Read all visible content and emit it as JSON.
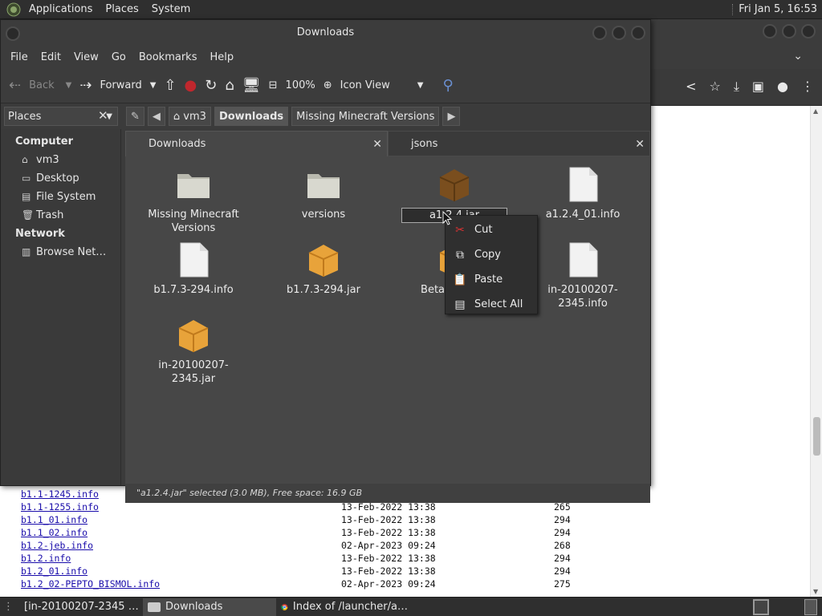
{
  "top_panel": {
    "menus": [
      "Applications",
      "Places",
      "System"
    ],
    "clock": "Fri Jan 5, 16:53"
  },
  "chrome": {
    "listing": [
      {
        "name": "b1.1-1245.info",
        "date": "13-Feb-2022 13:38",
        "size": "265"
      },
      {
        "name": "b1.1-1255.info",
        "date": "13-Feb-2022 13:38",
        "size": "265"
      },
      {
        "name": "b1.1_01.info",
        "date": "13-Feb-2022 13:38",
        "size": "294"
      },
      {
        "name": "b1.1_02.info",
        "date": "13-Feb-2022 13:38",
        "size": "294"
      },
      {
        "name": "b1.2-jeb.info",
        "date": "02-Apr-2023 09:24",
        "size": "268"
      },
      {
        "name": "b1.2.info",
        "date": "13-Feb-2022 13:38",
        "size": "294"
      },
      {
        "name": "b1.2_01.info",
        "date": "13-Feb-2022 13:38",
        "size": "294"
      },
      {
        "name": "b1.2_02-PEPTO_BISMOL.info",
        "date": "02-Apr-2023 09:24",
        "size": "275"
      }
    ]
  },
  "nautilus": {
    "title": "Downloads",
    "menu": [
      "File",
      "Edit",
      "View",
      "Go",
      "Bookmarks",
      "Help"
    ],
    "toolbar": {
      "back": "Back",
      "forward": "Forward",
      "zoom": "100%",
      "view_mode": "Icon View"
    },
    "places_label": "Places",
    "breadcrumbs": [
      "vm3",
      "Downloads",
      "Missing Minecraft Versions"
    ],
    "sidebar": {
      "computer_header": "Computer",
      "computer_items": [
        "vm3",
        "Desktop",
        "File System",
        "Trash"
      ],
      "network_header": "Network",
      "network_items": [
        "Browse Net…"
      ]
    },
    "tabs": [
      "Downloads",
      "jsons"
    ],
    "files": [
      {
        "label": "Missing Minecraft Versions",
        "type": "folder"
      },
      {
        "label": "versions",
        "type": "folder"
      },
      {
        "label": "a1.2.4.jar",
        "type": "jar-selected"
      },
      {
        "label": "a1.2.4_01.info",
        "type": "doc"
      },
      {
        "label": "b1.7.3-294.info",
        "type": "doc"
      },
      {
        "label": "b1.7.3-294.jar",
        "type": "jar"
      },
      {
        "label": "Betacra Arch",
        "type": "jar"
      },
      {
        "label": "in-20100207-2345.info",
        "type": "doc"
      },
      {
        "label": "in-20100207-2345.jar",
        "type": "jar"
      }
    ],
    "status": "\"a1.2.4.jar\" selected (3.0 MB), Free space: 16.9 GB"
  },
  "context_menu": {
    "items": [
      {
        "label": "Cut",
        "icon": "scissors-icon"
      },
      {
        "label": "Copy",
        "icon": "copy-icon"
      },
      {
        "label": "Paste",
        "icon": "paste-icon"
      },
      {
        "label": "Select All",
        "icon": "select-all-icon"
      }
    ]
  },
  "taskbar": {
    "tasks": [
      "[in-20100207-2345 …",
      "Downloads",
      "Index of /launcher/a…"
    ]
  }
}
